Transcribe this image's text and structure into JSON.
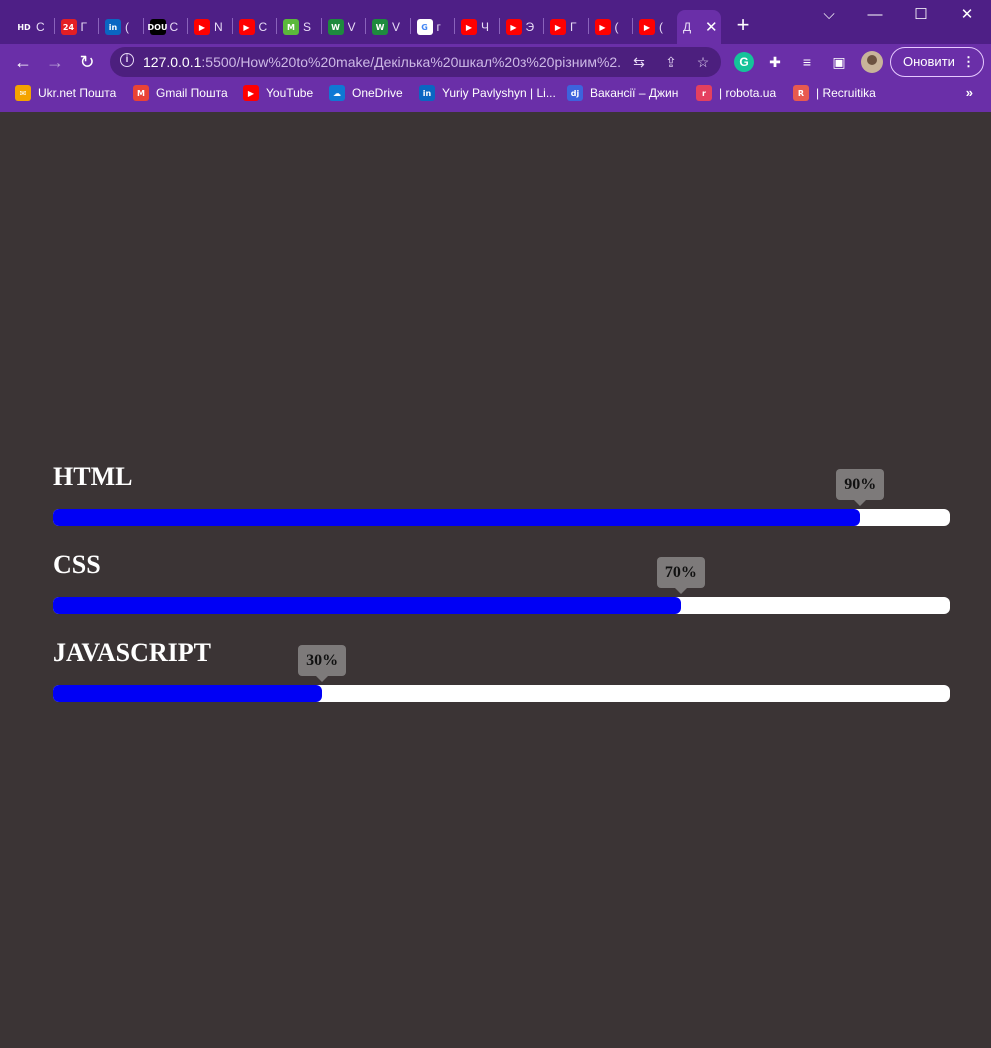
{
  "browser": {
    "tabs": [
      {
        "favicon": "hd-icon",
        "fav_text": "HD",
        "fav_color": "#4e1f86",
        "title": "С"
      },
      {
        "favicon": "24-icon",
        "fav_text": "24",
        "fav_color": "#e31e24",
        "title": "Г"
      },
      {
        "favicon": "linkedin-icon",
        "fav_text": "in",
        "fav_color": "#0a66c2",
        "title": "("
      },
      {
        "favicon": "dou-icon",
        "fav_text": "DOU",
        "fav_color": "#000000",
        "title": "С"
      },
      {
        "favicon": "youtube-icon",
        "fav_text": "▶",
        "fav_color": "#ff0000",
        "title": "N"
      },
      {
        "favicon": "youtube-icon",
        "fav_text": "▶",
        "fav_color": "#ff0000",
        "title": "С"
      },
      {
        "favicon": "m-icon",
        "fav_text": "M",
        "fav_color": "#5bb83b",
        "title": "S"
      },
      {
        "favicon": "w-icon",
        "fav_text": "W",
        "fav_color": "#1e8a3e",
        "title": "V"
      },
      {
        "favicon": "w-icon",
        "fav_text": "W",
        "fav_color": "#1e8a3e",
        "title": "V"
      },
      {
        "favicon": "google-icon",
        "fav_text": "G",
        "fav_color": "#ffffff",
        "title": "г"
      },
      {
        "favicon": "youtube-icon",
        "fav_text": "▶",
        "fav_color": "#ff0000",
        "title": "Ч"
      },
      {
        "favicon": "youtube-icon",
        "fav_text": "▶",
        "fav_color": "#ff0000",
        "title": "Э"
      },
      {
        "favicon": "youtube-icon",
        "fav_text": "▶",
        "fav_color": "#ff0000",
        "title": "Г"
      },
      {
        "favicon": "youtube-icon",
        "fav_text": "▶",
        "fav_color": "#ff0000",
        "title": "("
      },
      {
        "favicon": "youtube-icon",
        "fav_text": "▶",
        "fav_color": "#ff0000",
        "title": "("
      }
    ],
    "active_tab": {
      "title": "Д",
      "close": "✕"
    },
    "new_tab": "+",
    "window": {
      "tabsearch": "⌵",
      "minimize": "—",
      "maximize": "☐",
      "close": "✕"
    },
    "nav": {
      "back": "←",
      "forward": "→",
      "reload": "↻"
    },
    "url_host": "127.0.0.1",
    "url_rest": ":5500/How%20to%20make/Декілька%20шкал%20з%20різним%2...",
    "update_label": "Оновити",
    "bookmarks": [
      {
        "icon": "ukrnet-icon",
        "fav_text": "✉",
        "fav_color": "#f4a300",
        "label": "Ukr.net Пошта"
      },
      {
        "icon": "gmail-icon",
        "fav_text": "M",
        "fav_color": "#ea4335",
        "label": "Gmail Пошта"
      },
      {
        "icon": "youtube-icon",
        "fav_text": "▶",
        "fav_color": "#ff0000",
        "label": "YouTube"
      },
      {
        "icon": "onedrive-icon",
        "fav_text": "☁",
        "fav_color": "#0f78d4",
        "label": "OneDrive"
      },
      {
        "icon": "linkedin-icon",
        "fav_text": "in",
        "fav_color": "#0a66c2",
        "label": "Yuriy Pavlyshyn | Li..."
      },
      {
        "icon": "djinni-icon",
        "fav_text": "dj",
        "fav_color": "#3d63dd",
        "label": "Вакансії – Джин"
      },
      {
        "icon": "robota-icon",
        "fav_text": "r",
        "fav_color": "#e4405f",
        "label": "| robota.ua"
      },
      {
        "icon": "recruitika-icon",
        "fav_text": "R",
        "fav_color": "#e85a4f",
        "label": "| Recruitika"
      }
    ],
    "bookmarks_more": "»"
  },
  "skills": [
    {
      "name": "HTML",
      "percent": 90,
      "label": "90%"
    },
    {
      "name": "CSS",
      "percent": 70,
      "label": "70%"
    },
    {
      "name": "JAVASCRIPT",
      "percent": 30,
      "label": "30%"
    }
  ],
  "colors": {
    "fill": "#0000f5",
    "track": "#ffffff",
    "tooltip": "#7d7a7a",
    "page_bg": "#3b3435"
  }
}
